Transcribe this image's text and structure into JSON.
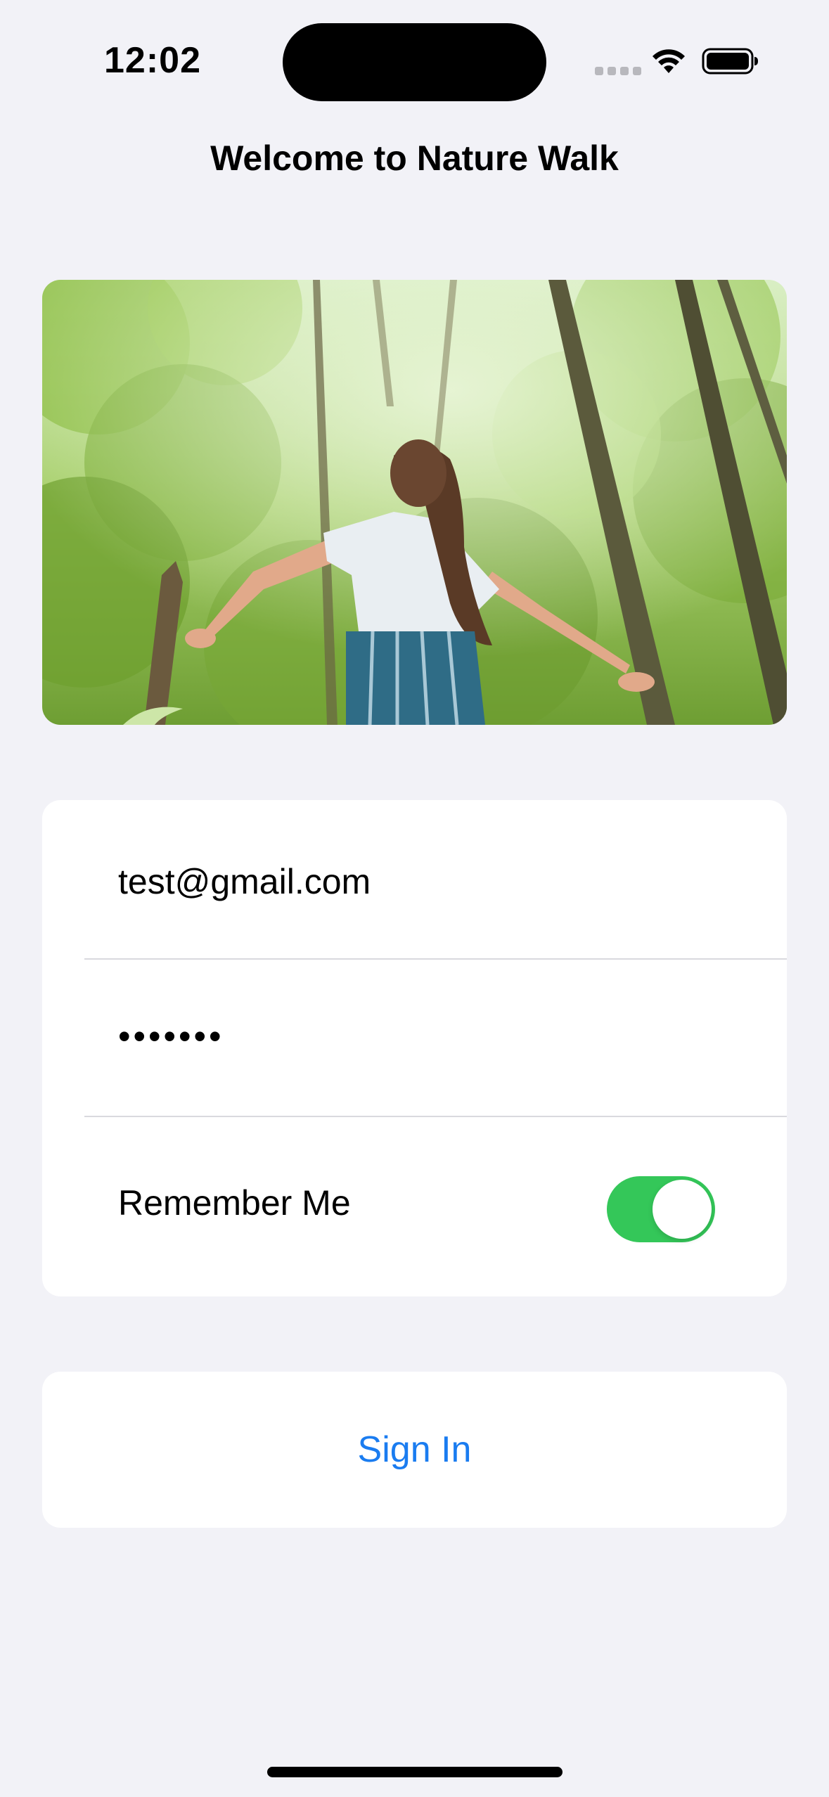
{
  "status_bar": {
    "time": "12:02",
    "icons": [
      "cellular-signal-icon",
      "wifi-icon",
      "battery-icon"
    ]
  },
  "screen": {
    "title": "Welcome to Nature Walk"
  },
  "hero_image": {
    "description": "woman-in-forest-photo"
  },
  "form": {
    "email_value": "test@gmail.com",
    "password_value": "•••••••",
    "remember_label": "Remember Me",
    "remember_enabled": true
  },
  "actions": {
    "sign_in_label": "Sign In"
  },
  "colors": {
    "background": "#F2F2F7",
    "card": "#FFFFFF",
    "accent": "#1A7CF0",
    "toggle_on": "#34C759"
  }
}
